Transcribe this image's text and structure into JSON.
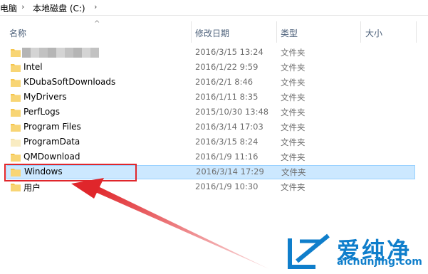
{
  "breadcrumb": {
    "items": [
      "电脑",
      "本地磁盘 (C:)"
    ]
  },
  "columns": {
    "name": "名称",
    "date": "修改日期",
    "type": "类型",
    "size": "大小"
  },
  "rows": [
    {
      "name": "",
      "date": "2016/3/15 13:24",
      "type": "文件夹"
    },
    {
      "name": "Intel",
      "date": "2016/1/22 9:59",
      "type": "文件夹"
    },
    {
      "name": "KDubaSoftDownloads",
      "date": "2016/2/1 8:46",
      "type": "文件夹"
    },
    {
      "name": "MyDrivers",
      "date": "2016/1/11 8:35",
      "type": "文件夹"
    },
    {
      "name": "PerfLogs",
      "date": "2015/10/30 13:48",
      "type": "文件夹"
    },
    {
      "name": "Program Files",
      "date": "2016/3/14 17:03",
      "type": "文件夹"
    },
    {
      "name": "ProgramData",
      "date": "2016/3/15 8:24",
      "type": "文件夹"
    },
    {
      "name": "QMDownload",
      "date": "2016/1/9 11:16",
      "type": "文件夹"
    },
    {
      "name": "Windows",
      "date": "2016/3/14 17:29",
      "type": "文件夹"
    },
    {
      "name": "用户",
      "date": "2016/1/9 10:30",
      "type": "文件夹"
    }
  ],
  "watermark": {
    "text": "爱纯净",
    "url": "aichunjing.com"
  },
  "colors": {
    "selection_bg": "#cce8ff",
    "selection_border": "#99d1ff",
    "annotation_red": "#e0262b",
    "folder_yellow": "#f5c54b",
    "watermark_blue": "#0f7ecb"
  }
}
